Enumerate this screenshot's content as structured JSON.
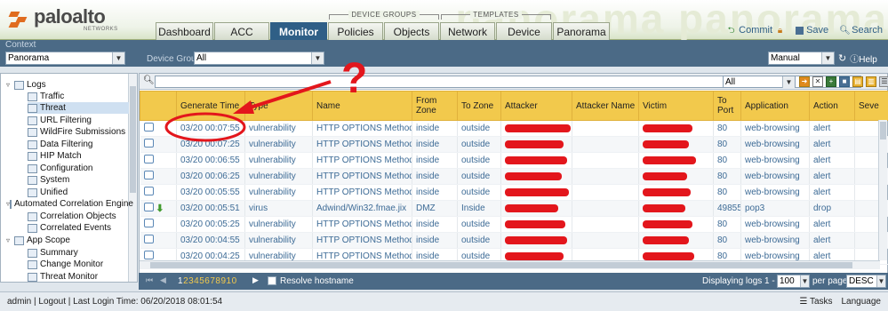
{
  "brand": {
    "name": "paloalto",
    "sub": "NETWORKS",
    "watermark": "panorama panorama"
  },
  "groups": {
    "device_groups": "DEVICE GROUPS",
    "templates": "TEMPLATES"
  },
  "tabs": [
    "Dashboard",
    "ACC",
    "Monitor",
    "Policies",
    "Objects",
    "Network",
    "Device",
    "Panorama"
  ],
  "active_tab": "Monitor",
  "header_actions": {
    "commit": "Commit",
    "save": "Save",
    "search": "Search"
  },
  "context": {
    "label": "Context",
    "value": "Panorama",
    "device_group_label": "Device Group",
    "device_group_value": "All",
    "refresh_mode": "Manual",
    "help": "Help"
  },
  "sidebar": {
    "items": [
      {
        "label": "Logs",
        "level": 0
      },
      {
        "label": "Traffic",
        "level": 1
      },
      {
        "label": "Threat",
        "level": 1,
        "selected": true
      },
      {
        "label": "URL Filtering",
        "level": 1
      },
      {
        "label": "WildFire Submissions",
        "level": 1
      },
      {
        "label": "Data Filtering",
        "level": 1
      },
      {
        "label": "HIP Match",
        "level": 1
      },
      {
        "label": "Configuration",
        "level": 1
      },
      {
        "label": "System",
        "level": 1
      },
      {
        "label": "Unified",
        "level": 1
      },
      {
        "label": "Automated Correlation Engine",
        "level": 0
      },
      {
        "label": "Correlation Objects",
        "level": 1
      },
      {
        "label": "Correlated Events",
        "level": 1
      },
      {
        "label": "App Scope",
        "level": 0
      },
      {
        "label": "Summary",
        "level": 1
      },
      {
        "label": "Change Monitor",
        "level": 1
      },
      {
        "label": "Threat Monitor",
        "level": 1
      }
    ]
  },
  "filter": {
    "scope_value": "All"
  },
  "table": {
    "headers": [
      "",
      "Generate Time",
      "Type",
      "Name",
      "From Zone",
      "To Zone",
      "Attacker",
      "Attacker Name",
      "Victim",
      "To Port",
      "Application",
      "Action",
      "Seve"
    ],
    "rows": [
      {
        "time": "03/20 00:07:55",
        "type": "vulnerability",
        "name": "HTTP OPTIONS Method",
        "from": "inside",
        "to": "outside",
        "port": "80",
        "app": "web-browsing",
        "action": "alert",
        "dl": false
      },
      {
        "time": "03/20 00:07:25",
        "type": "vulnerability",
        "name": "HTTP OPTIONS Method",
        "from": "inside",
        "to": "outside",
        "port": "80",
        "app": "web-browsing",
        "action": "alert",
        "dl": false
      },
      {
        "time": "03/20 00:06:55",
        "type": "vulnerability",
        "name": "HTTP OPTIONS Method",
        "from": "inside",
        "to": "outside",
        "port": "80",
        "app": "web-browsing",
        "action": "alert",
        "dl": false
      },
      {
        "time": "03/20 00:06:25",
        "type": "vulnerability",
        "name": "HTTP OPTIONS Method",
        "from": "inside",
        "to": "outside",
        "port": "80",
        "app": "web-browsing",
        "action": "alert",
        "dl": false
      },
      {
        "time": "03/20 00:05:55",
        "type": "vulnerability",
        "name": "HTTP OPTIONS Method",
        "from": "inside",
        "to": "outside",
        "port": "80",
        "app": "web-browsing",
        "action": "alert",
        "dl": false
      },
      {
        "time": "03/20 00:05:51",
        "type": "virus",
        "name": "Adwind/Win32.fmae.jix",
        "from": "DMZ",
        "to": "Inside",
        "port": "49855",
        "app": "pop3",
        "action": "drop",
        "dl": true
      },
      {
        "time": "03/20 00:05:25",
        "type": "vulnerability",
        "name": "HTTP OPTIONS Method",
        "from": "inside",
        "to": "outside",
        "port": "80",
        "app": "web-browsing",
        "action": "alert",
        "dl": false
      },
      {
        "time": "03/20 00:04:55",
        "type": "vulnerability",
        "name": "HTTP OPTIONS Method",
        "from": "inside",
        "to": "outside",
        "port": "80",
        "app": "web-browsing",
        "action": "alert",
        "dl": false
      },
      {
        "time": "03/20 00:04:25",
        "type": "vulnerability",
        "name": "HTTP OPTIONS Method",
        "from": "inside",
        "to": "outside",
        "port": "80",
        "app": "web-browsing",
        "action": "alert",
        "dl": false
      }
    ]
  },
  "pager": {
    "pages": "12345678910",
    "resolve_label": "Resolve hostname",
    "displaying": "Displaying logs 1 - 100",
    "per_page_value": "100",
    "per_page_label": "per page",
    "order": "DESC"
  },
  "status": {
    "user": "admin",
    "logout": "Logout",
    "last_login": "Last Login Time: 06/20/2018 08:01:54",
    "tasks": "Tasks",
    "language": "Language"
  },
  "annotation": {
    "mark": "?"
  },
  "colors": {
    "accent": "#2f5f86",
    "header_row": "#f2c94c",
    "redaction": "#e3161c"
  }
}
